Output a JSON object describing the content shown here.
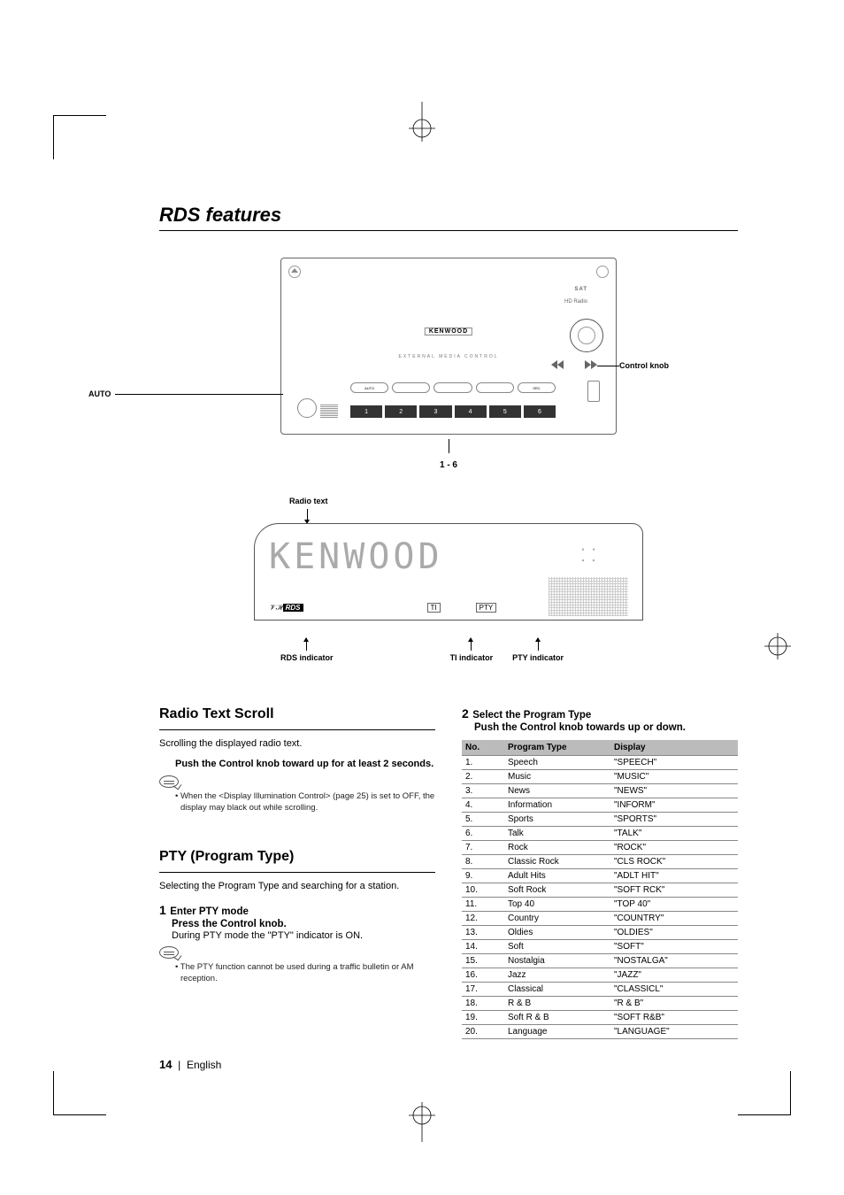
{
  "section_title": "RDS features",
  "device": {
    "label_auto": "AUTO",
    "label_control_knob": "Control knob",
    "label_16": "1 - 6",
    "brand": "KENWOOD",
    "sat_label": "SAT",
    "hd_label": "HD Radio",
    "subtitle": "EXTERNAL MEDIA CONTROL",
    "num_buttons": [
      "1",
      "2",
      "3",
      "4",
      "5",
      "6"
    ],
    "pill_labels": [
      "AUTO",
      "",
      "",
      "",
      "SRC"
    ]
  },
  "lcd": {
    "label_radio_text": "Radio text",
    "display_text": "KENWOOD",
    "rds_text": "RDS",
    "ti_text": "TI",
    "pty_text": "PTY",
    "label_rds": "RDS indicator",
    "label_ti": "TI indicator",
    "label_pty": "PTY indicator"
  },
  "left": {
    "h2a": "Radio Text Scroll",
    "p1": "Scrolling the displayed radio text.",
    "p2": "Push the Control knob toward up for at least 2 seconds.",
    "note1": "When the <Display Illumination Control> (page 25) is set to OFF, the display may black out while scrolling.",
    "h2b": "PTY (Program Type)",
    "p3": "Selecting the Program Type and searching for a station.",
    "s1_num": "1",
    "s1_title": "Enter PTY mode",
    "s1_sub": "Press the Control knob.",
    "s1_body": "During PTY mode the \"PTY\" indicator is ON.",
    "note2": "The PTY function cannot be used during a traffic bulletin or AM reception."
  },
  "right": {
    "s2_num": "2",
    "s2_title": "Select the Program Type",
    "s2_sub": "Push the Control knob towards up or down.",
    "th_no": "No.",
    "th_type": "Program Type",
    "th_display": "Display",
    "rows": [
      {
        "n": "1.",
        "t": "Speech",
        "d": "\"SPEECH\""
      },
      {
        "n": "2.",
        "t": "Music",
        "d": "\"MUSIC\""
      },
      {
        "n": "3.",
        "t": "News",
        "d": "\"NEWS\""
      },
      {
        "n": "4.",
        "t": "Information",
        "d": "\"INFORM\""
      },
      {
        "n": "5.",
        "t": "Sports",
        "d": "\"SPORTS\""
      },
      {
        "n": "6.",
        "t": "Talk",
        "d": "\"TALK\""
      },
      {
        "n": "7.",
        "t": "Rock",
        "d": "\"ROCK\""
      },
      {
        "n": "8.",
        "t": "Classic Rock",
        "d": "\"CLS ROCK\""
      },
      {
        "n": "9.",
        "t": "Adult Hits",
        "d": "\"ADLT HIT\""
      },
      {
        "n": "10.",
        "t": "Soft Rock",
        "d": "\"SOFT RCK\""
      },
      {
        "n": "11.",
        "t": "Top 40",
        "d": "\"TOP 40\""
      },
      {
        "n": "12.",
        "t": "Country",
        "d": "\"COUNTRY\""
      },
      {
        "n": "13.",
        "t": "Oldies",
        "d": "\"OLDIES\""
      },
      {
        "n": "14.",
        "t": "Soft",
        "d": "\"SOFT\""
      },
      {
        "n": "15.",
        "t": "Nostalgia",
        "d": "\"NOSTALGA\""
      },
      {
        "n": "16.",
        "t": "Jazz",
        "d": "\"JAZZ\""
      },
      {
        "n": "17.",
        "t": "Classical",
        "d": "\"CLASSICL\""
      },
      {
        "n": "18.",
        "t": "R & B",
        "d": "\"R & B\""
      },
      {
        "n": "19.",
        "t": "Soft R & B",
        "d": "\"SOFT R&B\""
      },
      {
        "n": "20.",
        "t": "Language",
        "d": "\"LANGUAGE\""
      }
    ]
  },
  "footer": {
    "page": "14",
    "sep": "|",
    "lang": "English"
  }
}
